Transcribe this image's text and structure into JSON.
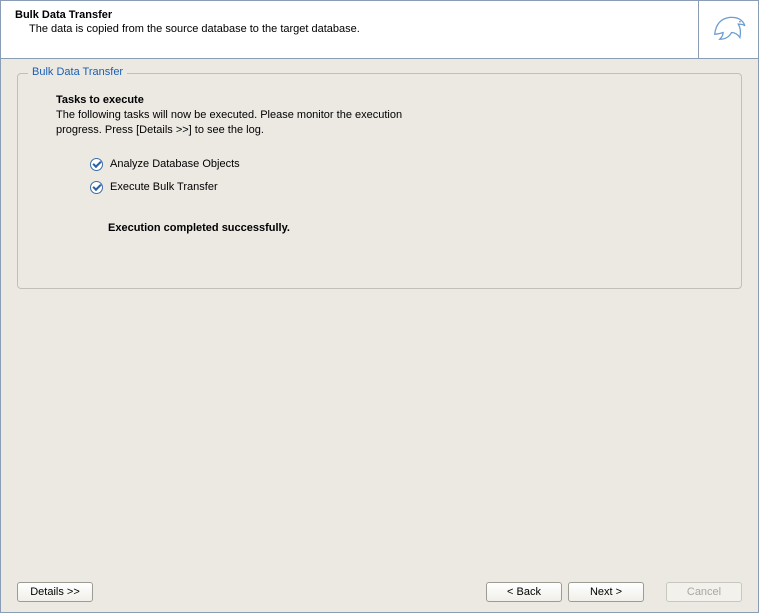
{
  "header": {
    "title": "Bulk Data Transfer",
    "subtitle": "The data is copied from the source database to the target database."
  },
  "panel": {
    "legend": "Bulk Data Transfer",
    "tasks_title": "Tasks to execute",
    "tasks_desc": "The following tasks will now be executed. Please monitor the execution progress. Press [Details >>] to see the log.",
    "tasks": [
      {
        "label": "Analyze Database Objects"
      },
      {
        "label": "Execute Bulk Transfer"
      }
    ],
    "completion": "Execution completed successfully."
  },
  "footer": {
    "details": "Details >>",
    "back": "< Back",
    "next": "Next >",
    "cancel": "Cancel"
  }
}
